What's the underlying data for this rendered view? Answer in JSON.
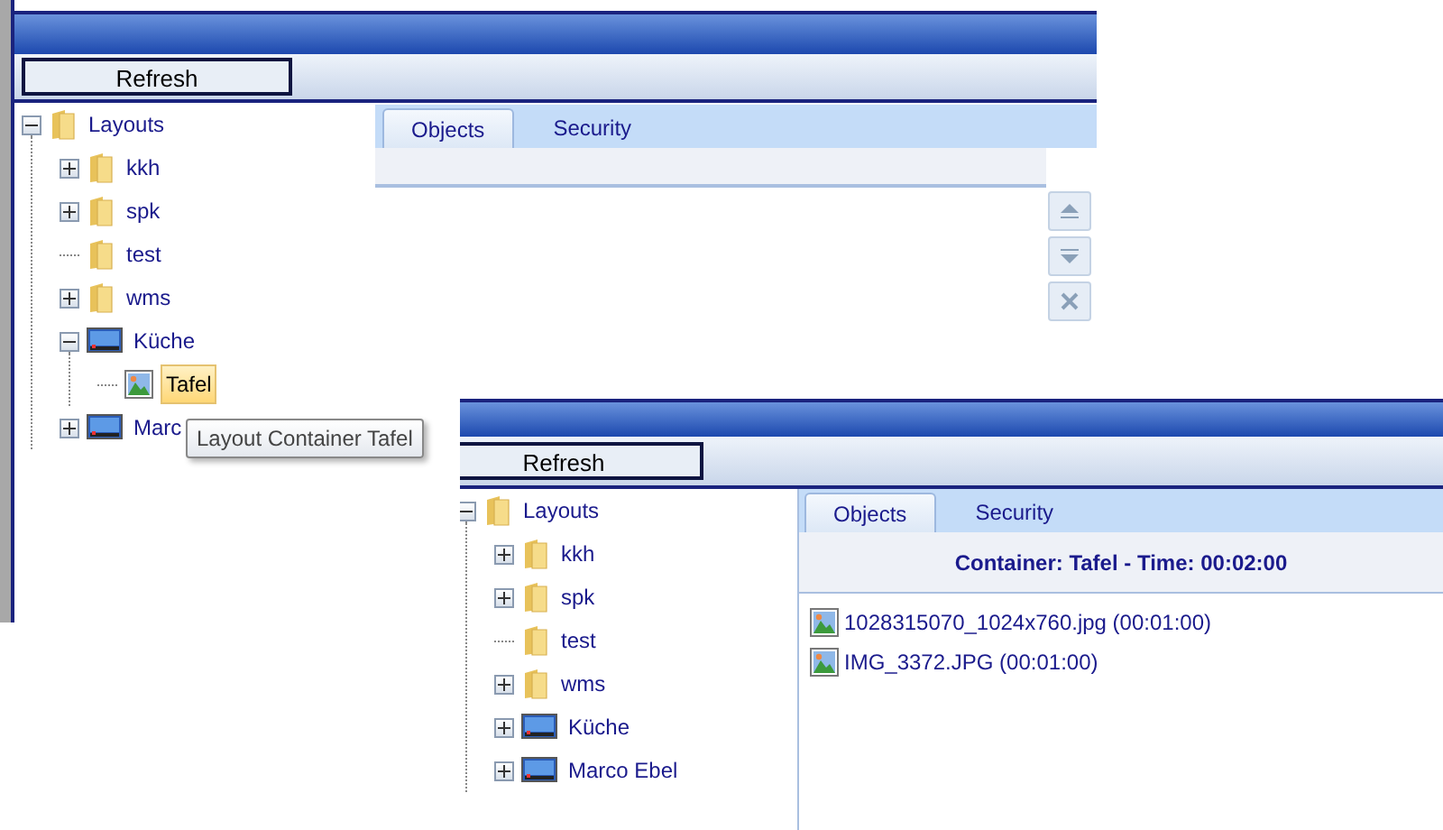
{
  "windows": [
    {
      "toolbar": {
        "refresh_button": "Refresh"
      },
      "tree": [
        {
          "label": "Layouts",
          "kind": "folder",
          "expanded": true,
          "selected": false,
          "children": [
            {
              "label": "kkh",
              "kind": "folder",
              "expanded": false,
              "selected": false
            },
            {
              "label": "spk",
              "kind": "folder",
              "expanded": false,
              "selected": false
            },
            {
              "label": "test",
              "kind": "folder",
              "selected": false
            },
            {
              "label": "wms",
              "kind": "folder",
              "expanded": false,
              "selected": false
            },
            {
              "label": "Küche",
              "kind": "screen",
              "expanded": true,
              "selected": false,
              "children": [
                {
                  "label": "Tafel",
                  "kind": "image",
                  "selected": true
                }
              ]
            },
            {
              "label": "Marc",
              "kind": "screen",
              "expanded": false,
              "selected": false
            }
          ]
        }
      ],
      "tabs": [
        {
          "label": "Objects",
          "selected": true
        },
        {
          "label": "Security",
          "selected": false
        }
      ],
      "side_buttons": [
        {
          "kind": "up"
        },
        {
          "kind": "down"
        },
        {
          "kind": "delete"
        }
      ],
      "tooltip": "Layout Container Tafel"
    },
    {
      "toolbar": {
        "refresh_button": "Refresh"
      },
      "tree": [
        {
          "label": "Layouts",
          "kind": "folder",
          "expanded": true,
          "selected": false,
          "children": [
            {
              "label": "kkh",
              "kind": "folder",
              "expanded": false,
              "selected": false
            },
            {
              "label": "spk",
              "kind": "folder",
              "expanded": false,
              "selected": false
            },
            {
              "label": "test",
              "kind": "folder",
              "selected": false
            },
            {
              "label": "wms",
              "kind": "folder",
              "expanded": false,
              "selected": false
            },
            {
              "label": "Küche",
              "kind": "screen",
              "expanded": false,
              "selected": false
            },
            {
              "label": "Marco Ebel",
              "kind": "screen",
              "expanded": false,
              "selected": false
            }
          ]
        }
      ],
      "tabs": [
        {
          "label": "Objects",
          "selected": true
        },
        {
          "label": "Security",
          "selected": false
        }
      ],
      "header": "Container: Tafel - Time: 00:02:00",
      "objects": [
        {
          "label": "1028315070_1024x760.jpg (00:01:00)"
        },
        {
          "label": "IMG_3372.JPG (00:01:00)"
        }
      ]
    }
  ]
}
